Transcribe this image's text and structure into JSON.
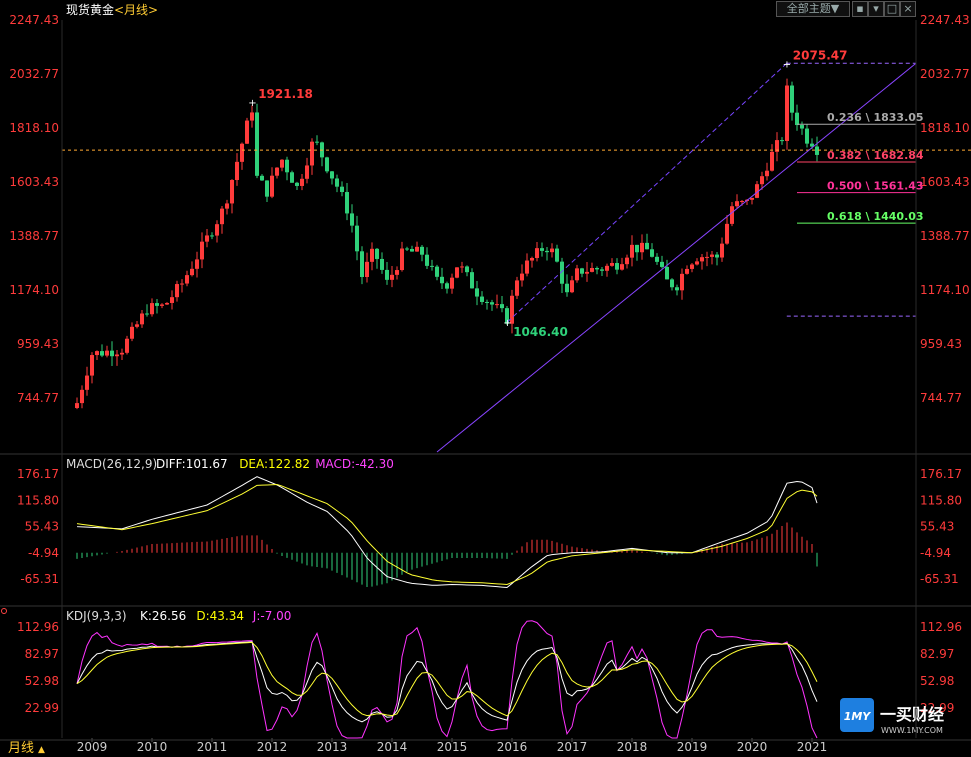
{
  "header": {
    "symbol": "现货黄金",
    "period_tag": "<月线>",
    "theme_button": "全部主题▼",
    "colors": {
      "up": "#ff3b3b",
      "down": "#2fd17a",
      "title": "#ffffff",
      "tag": "#ffcc33"
    }
  },
  "bottom_bar": {
    "period_label": "月线"
  },
  "watermark": {
    "logo_text": "1MY",
    "brand": "一买财经",
    "url": "WWW.1MY.COM"
  },
  "chart_data": [
    {
      "type": "candlestick",
      "name": "main",
      "y_ticks": [
        "2247.43",
        "2032.77",
        "1818.10",
        "1603.43",
        "1388.77",
        "1174.10",
        "959.43",
        "744.77"
      ],
      "y_tick_values": [
        2247.43,
        2032.77,
        1818.1,
        1603.43,
        1388.77,
        1174.1,
        959.43,
        744.77
      ],
      "ylim": [
        540,
        2300
      ],
      "x_labels": [
        "2009",
        "2010",
        "2011",
        "2012",
        "2013",
        "2014",
        "2015",
        "2016",
        "2017",
        "2018",
        "2019",
        "2020",
        "2021"
      ],
      "x_start": "2008-10",
      "x_end": "2021-01",
      "trend_closes": [
        [
          2008.75,
          725
        ],
        [
          2009.0,
          920
        ],
        [
          2009.5,
          940
        ],
        [
          2009.92,
          1100
        ],
        [
          2010.2,
          1110
        ],
        [
          2010.5,
          1200
        ],
        [
          2010.92,
          1380
        ],
        [
          2011.2,
          1500
        ],
        [
          2011.55,
          1800
        ],
        [
          2011.67,
          1900
        ],
        [
          2011.75,
          1620
        ],
        [
          2011.92,
          1565
        ],
        [
          2012.15,
          1700
        ],
        [
          2012.42,
          1580
        ],
        [
          2012.7,
          1775
        ],
        [
          2012.92,
          1665
        ],
        [
          2013.1,
          1580
        ],
        [
          2013.3,
          1470
        ],
        [
          2013.5,
          1230
        ],
        [
          2013.7,
          1330
        ],
        [
          2013.92,
          1200
        ],
        [
          2014.2,
          1330
        ],
        [
          2014.5,
          1320
        ],
        [
          2014.75,
          1210
        ],
        [
          2014.92,
          1200
        ],
        [
          2015.1,
          1280
        ],
        [
          2015.4,
          1170
        ],
        [
          2015.7,
          1110
        ],
        [
          2015.92,
          1060
        ],
        [
          2016.1,
          1240
        ],
        [
          2016.55,
          1350
        ],
        [
          2016.7,
          1320
        ],
        [
          2016.92,
          1150
        ],
        [
          2017.1,
          1250
        ],
        [
          2017.5,
          1260
        ],
        [
          2017.75,
          1280
        ],
        [
          2018.0,
          1345
        ],
        [
          2018.3,
          1330
        ],
        [
          2018.6,
          1200
        ],
        [
          2018.75,
          1195
        ],
        [
          2018.92,
          1280
        ],
        [
          2019.1,
          1310
        ],
        [
          2019.42,
          1305
        ],
        [
          2019.67,
          1510
        ],
        [
          2019.92,
          1520
        ],
        [
          2020.1,
          1590
        ],
        [
          2020.3,
          1700
        ],
        [
          2020.5,
          1780
        ],
        [
          2020.58,
          1970
        ],
        [
          2020.67,
          1880
        ],
        [
          2020.92,
          1775
        ],
        [
          2021.0,
          1765
        ],
        [
          2021.1,
          1730
        ]
      ],
      "annotations": [
        {
          "text": "1921.18",
          "date": 2011.67,
          "value": 1921.18,
          "color": "#ff3b3b"
        },
        {
          "text": "2075.47",
          "date": 2020.58,
          "value": 2075.47,
          "color": "#ff3b3b"
        },
        {
          "text": "1046.40",
          "date": 2015.92,
          "value": 1046.4,
          "color": "#2fd17a"
        }
      ],
      "current_price_line": 1730,
      "fibonacci": [
        {
          "ratio": "0.236",
          "value": 1833.05,
          "label": "0.236 \\ 1833.05",
          "color": "#aaaaaa"
        },
        {
          "ratio": "0.382",
          "value": 1682.84,
          "label": "0.382 \\ 1682.84",
          "color": "#ff4466"
        },
        {
          "ratio": "0.500",
          "value": 1561.43,
          "label": "0.500 \\ 1561.43",
          "color": "#ff3399"
        },
        {
          "ratio": "0.618",
          "value": 1440.03,
          "label": "0.618 \\ 1440.03",
          "color": "#66ff66"
        }
      ],
      "dotted_levels": [
        2075.47,
        1070
      ]
    },
    {
      "type": "macd",
      "label": "MACD(26,12,9)",
      "readouts": [
        {
          "text": "DIFF:101.67",
          "color": "#ffffff"
        },
        {
          "text": "DEA:122.82",
          "color": "#ffff00"
        },
        {
          "text": "MACD:-42.30",
          "color": "#ff44ff"
        }
      ],
      "y_ticks": [
        "176.17",
        "115.80",
        "55.43",
        "-4.94",
        "-65.31"
      ],
      "y_tick_values": [
        176.17,
        115.8,
        55.43,
        -4.94,
        -65.31
      ],
      "ylim": [
        -125,
        215
      ],
      "diff_trend": [
        [
          2008.75,
          55
        ],
        [
          2009.5,
          50
        ],
        [
          2010.0,
          72
        ],
        [
          2010.92,
          105
        ],
        [
          2011.5,
          150
        ],
        [
          2011.75,
          170
        ],
        [
          2012.1,
          150
        ],
        [
          2012.6,
          110
        ],
        [
          2012.92,
          90
        ],
        [
          2013.3,
          40
        ],
        [
          2013.6,
          -20
        ],
        [
          2013.92,
          -60
        ],
        [
          2014.3,
          -75
        ],
        [
          2014.7,
          -80
        ],
        [
          2015.0,
          -78
        ],
        [
          2015.5,
          -80
        ],
        [
          2015.92,
          -85
        ],
        [
          2016.3,
          -40
        ],
        [
          2016.6,
          -10
        ],
        [
          2017.0,
          -5
        ],
        [
          2017.5,
          -3
        ],
        [
          2018.0,
          5
        ],
        [
          2018.6,
          -5
        ],
        [
          2019.0,
          -5
        ],
        [
          2019.5,
          20
        ],
        [
          2019.92,
          40
        ],
        [
          2020.3,
          70
        ],
        [
          2020.58,
          155
        ],
        [
          2020.8,
          160
        ],
        [
          2021.0,
          145
        ],
        [
          2021.1,
          102
        ]
      ],
      "dea_trend": [
        [
          2008.75,
          62
        ],
        [
          2009.5,
          48
        ],
        [
          2010.0,
          62
        ],
        [
          2010.92,
          92
        ],
        [
          2011.5,
          130
        ],
        [
          2011.75,
          150
        ],
        [
          2012.1,
          152
        ],
        [
          2012.6,
          125
        ],
        [
          2012.92,
          108
        ],
        [
          2013.3,
          70
        ],
        [
          2013.6,
          20
        ],
        [
          2013.92,
          -25
        ],
        [
          2014.3,
          -55
        ],
        [
          2014.7,
          -68
        ],
        [
          2015.0,
          -72
        ],
        [
          2015.5,
          -74
        ],
        [
          2015.92,
          -78
        ],
        [
          2016.3,
          -55
        ],
        [
          2016.6,
          -25
        ],
        [
          2017.0,
          -12
        ],
        [
          2017.5,
          -5
        ],
        [
          2018.0,
          2
        ],
        [
          2018.6,
          -2
        ],
        [
          2019.0,
          -5
        ],
        [
          2019.5,
          10
        ],
        [
          2019.92,
          28
        ],
        [
          2020.3,
          50
        ],
        [
          2020.58,
          120
        ],
        [
          2020.8,
          140
        ],
        [
          2021.0,
          135
        ],
        [
          2021.1,
          123
        ]
      ]
    },
    {
      "type": "kdj",
      "label": "KDJ(9,3,3)",
      "readouts": [
        {
          "text": "K:26.56",
          "color": "#ffffff"
        },
        {
          "text": "D:43.34",
          "color": "#ffff00"
        },
        {
          "text": "J:-7.00",
          "color": "#ff44ff"
        }
      ],
      "y_ticks": [
        "112.96",
        "82.97",
        "52.98",
        "22.99"
      ],
      "y_tick_values": [
        112.96,
        82.97,
        52.98,
        22.99
      ],
      "ylim": [
        -10,
        130
      ]
    }
  ]
}
